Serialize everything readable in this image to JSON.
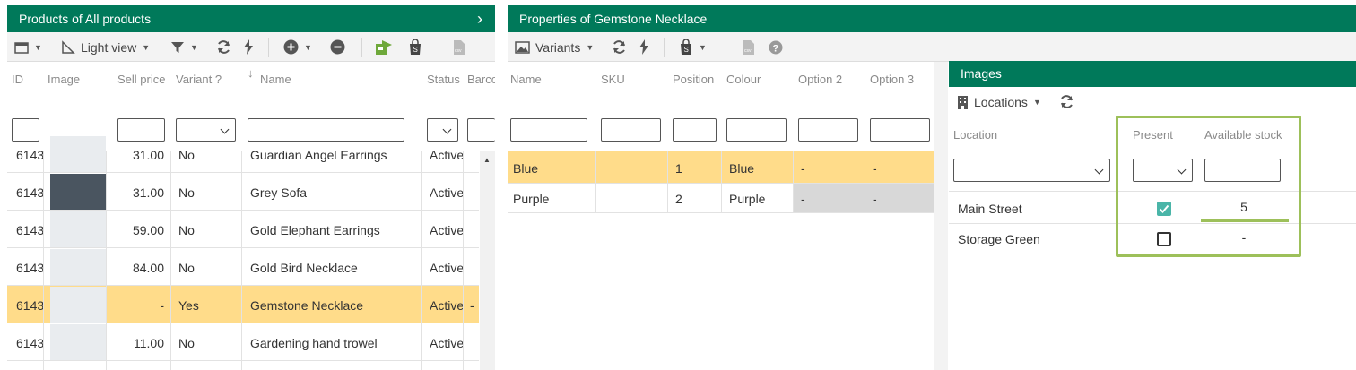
{
  "products_panel": {
    "title": "Products of All products",
    "toolbar": {
      "view_label": "Light view"
    },
    "columns": [
      "ID",
      "Image",
      "Sell price",
      "Variant ?",
      "Name",
      "Status",
      "Barco"
    ],
    "rows": [
      {
        "id": "6143",
        "price": "31.00",
        "variant": "No",
        "name": "Guardian Angel Earrings",
        "status": "Active",
        "extra": ""
      },
      {
        "id": "6143",
        "price": "31.00",
        "variant": "No",
        "name": "Grey Sofa",
        "status": "Active",
        "extra": ""
      },
      {
        "id": "6143",
        "price": "59.00",
        "variant": "No",
        "name": "Gold Elephant Earrings",
        "status": "Active",
        "extra": ""
      },
      {
        "id": "6143",
        "price": "84.00",
        "variant": "No",
        "name": "Gold Bird Necklace",
        "status": "Active",
        "extra": ""
      },
      {
        "id": "6143",
        "price": "-",
        "variant": "Yes",
        "name": "Gemstone Necklace",
        "status": "Active",
        "extra": "-"
      },
      {
        "id": "6143",
        "price": "11.00",
        "variant": "No",
        "name": "Gardening hand trowel",
        "status": "Active",
        "extra": ""
      }
    ]
  },
  "properties_panel": {
    "title": "Properties of Gemstone Necklace",
    "toolbar": {
      "variants_label": "Variants"
    },
    "columns": [
      "Name",
      "SKU",
      "Position",
      "Colour",
      "Option 2",
      "Option 3"
    ],
    "rows": [
      {
        "name": "Blue",
        "sku": "",
        "position": "1",
        "colour": "Blue",
        "opt2": "-",
        "opt3": "-"
      },
      {
        "name": "Purple",
        "sku": "",
        "position": "2",
        "colour": "Purple",
        "opt2": "-",
        "opt3": "-"
      }
    ]
  },
  "images_panel": {
    "title": "Images",
    "toolbar": {
      "locations_label": "Locations"
    },
    "columns": [
      "Location",
      "Present",
      "Available stock"
    ],
    "rows": [
      {
        "location": "Main Street",
        "present": true,
        "stock": "5"
      },
      {
        "location": "Storage Green",
        "present": false,
        "stock": "-"
      }
    ]
  },
  "colors": {
    "header_green": "#00795a",
    "selected_row": "#ffdc8a",
    "highlight_border": "#9dc05a",
    "checkbox_teal": "#4ab5a8"
  }
}
